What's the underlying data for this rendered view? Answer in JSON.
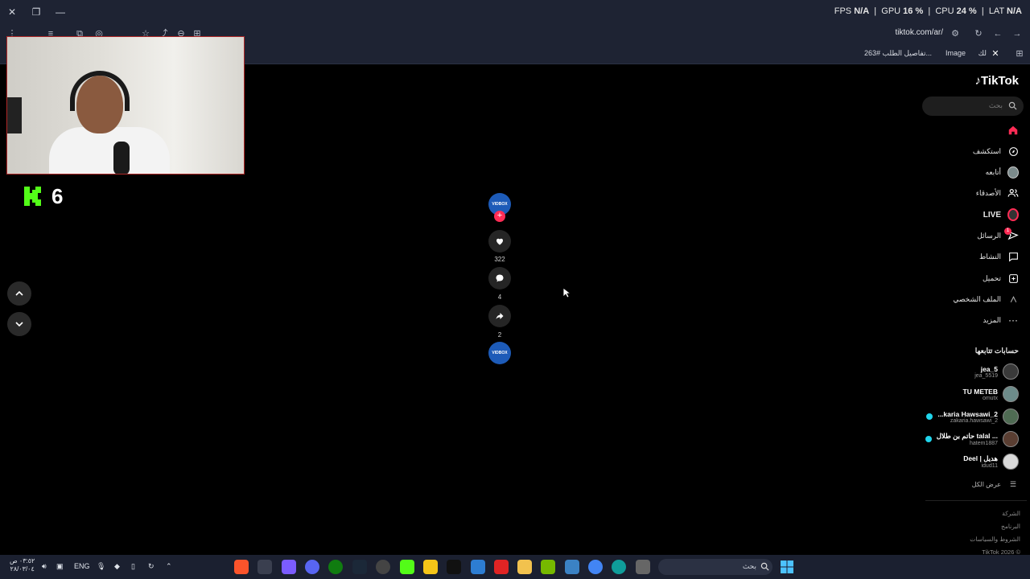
{
  "window": {
    "stats": {
      "fps_label": "FPS",
      "fps_value": "N/A",
      "gpu_label": "GPU",
      "gpu_value": "16 %",
      "cpu_label": "CPU",
      "cpu_value": "24 %",
      "lat_label": "LAT",
      "lat_value": "N/A"
    }
  },
  "browser": {
    "address": "tiktok.com/ar/",
    "bookmarks": [
      "تفاصيل الطلب #263...",
      "Image",
      "لك"
    ]
  },
  "stream_overlay": {
    "kick_viewers": "6"
  },
  "video_actions": {
    "creator_avatar_text": "VIDBOX",
    "likes": "322",
    "comments": "4",
    "shares": "2",
    "music_avatar_text": "VIDBOX"
  },
  "sidebar": {
    "logo": "TikTok",
    "search_placeholder": "بحث",
    "nav": [
      {
        "label": "",
        "icon": "home-icon"
      },
      {
        "label": "استكشف",
        "icon": "compass-icon"
      },
      {
        "label": "أتابعه",
        "icon": "avatar-icon"
      },
      {
        "label": "الأصدقاء",
        "icon": "friends-icon"
      },
      {
        "label": "LIVE",
        "icon": "live-icon"
      },
      {
        "label": "الرسائل",
        "icon": "messages-icon"
      },
      {
        "label": "النشاط",
        "icon": "activity-icon"
      },
      {
        "label": "تحميل",
        "icon": "upload-icon"
      },
      {
        "label": "الملف الشخصي",
        "icon": "profile-icon"
      },
      {
        "label": "المزيد",
        "icon": "more-icon"
      }
    ],
    "messages_badge": "1",
    "following_title": "حسابات تتابعها",
    "following": [
      {
        "name": "jea_5",
        "handle": "jea_5519",
        "live": false
      },
      {
        "name": "TU METEB",
        "handle": "omutx",
        "live": false
      },
      {
        "name": "...karia Hawsawi_2",
        "handle": "zakaria.hawsawi_2",
        "live": true
      },
      {
        "name": "حاتم بن طلال talal ...",
        "handle": "hatem1887",
        "live": true
      },
      {
        "name": "Deel | هديل",
        "handle": "idud11",
        "live": false
      }
    ],
    "show_all": "عرض الكل",
    "footer": [
      "الشركة",
      "البرنامج",
      "الشروط والسياسات",
      "TikTok 2026 ©"
    ]
  },
  "taskbar": {
    "time": "٠٣:٥٢ ص",
    "date": "٢٨/٠٣/٠٤",
    "lang": "ENG",
    "search_placeholder": "بحث"
  },
  "colors": {
    "accent": "#fe2c55",
    "live_ring": "#fe2c55",
    "kick_green": "#53fc18",
    "chrome_bg": "#1e2333"
  }
}
